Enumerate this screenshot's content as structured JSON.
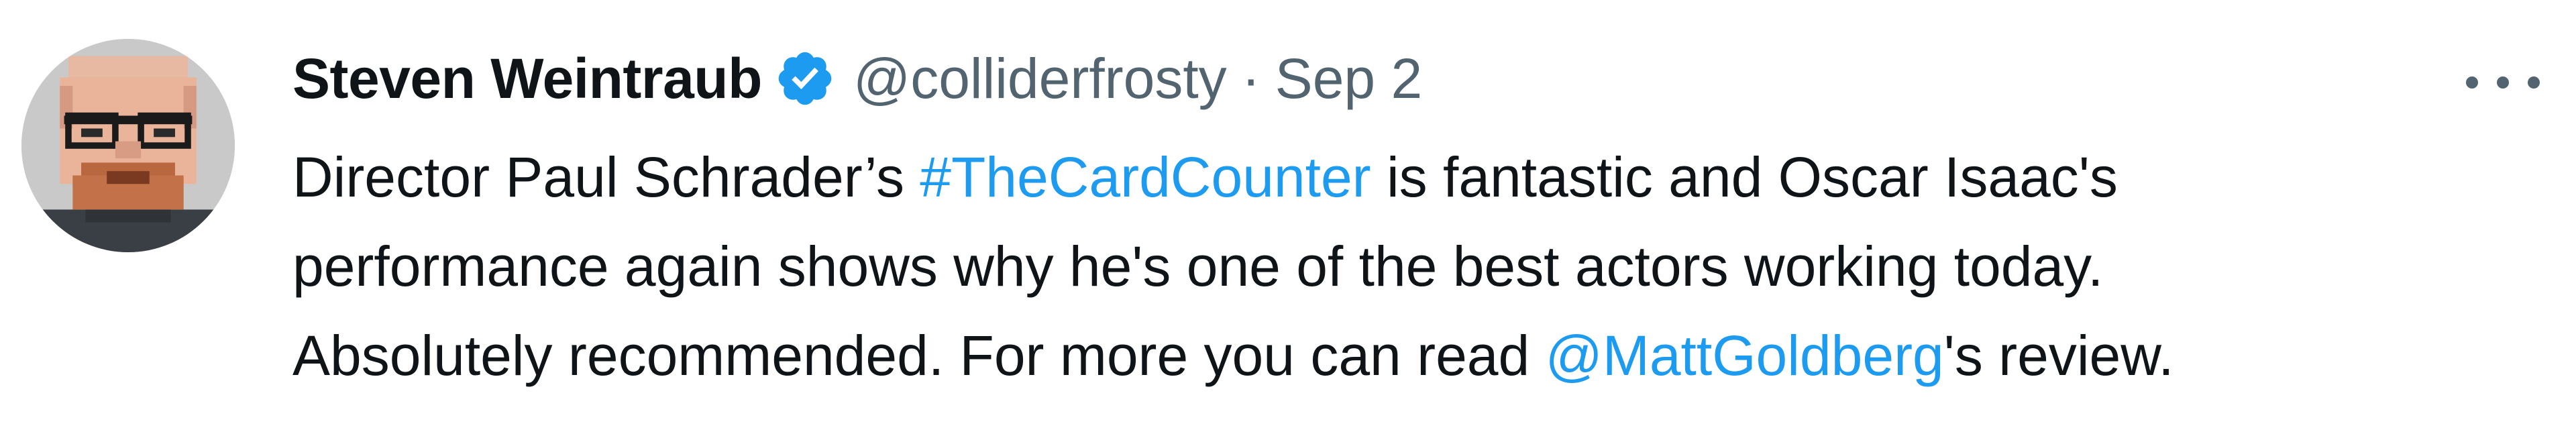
{
  "tweet": {
    "author": {
      "display_name": "Steven Weintraub",
      "handle": "@colliderfrosty",
      "verified": true,
      "avatar_icon": "pixel-art-avatar"
    },
    "separator": "·",
    "date": "Sep 2",
    "more_icon": "more-options-icon",
    "text": {
      "line1": {
        "before": "Director Paul Schrader’s ",
        "hashtag": "#TheCardCounter",
        "after": " is fantastic and Oscar Isaac's"
      },
      "line2": "performance again shows why he's one of the best actors working today.",
      "line3": {
        "before": "Absolutely recommended. For more you can read ",
        "mention": "@MattGoldberg",
        "after": "'s review."
      }
    }
  },
  "colors": {
    "text_primary": "#0f1419",
    "text_secondary": "#536471",
    "link": "#1d9bf0",
    "verified_badge": "#1d9bf0"
  }
}
